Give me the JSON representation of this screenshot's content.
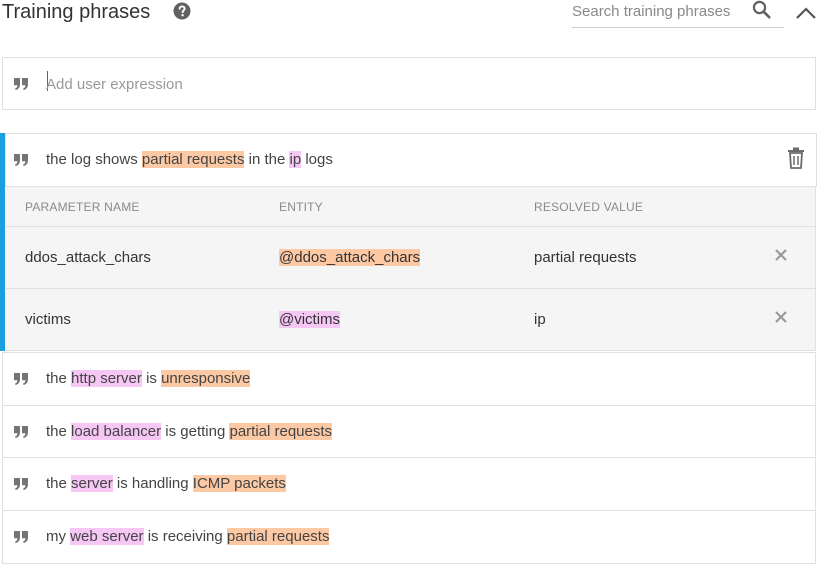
{
  "header": {
    "title": "Training phrases",
    "search_placeholder": "Search training phrases"
  },
  "add_expression": {
    "placeholder": "Add user expression"
  },
  "colors": {
    "accent": "#1a9fe0",
    "highlight_orange": "#fcc9a4",
    "highlight_pink": "#f6c6f4"
  },
  "phrases": [
    {
      "segments": [
        {
          "text": "the log shows ",
          "hl": "none"
        },
        {
          "text": "partial requests",
          "hl": "orange"
        },
        {
          "text": " in the ",
          "hl": "none"
        },
        {
          "text": "ip",
          "hl": "pink"
        },
        {
          "text": " logs",
          "hl": "none"
        }
      ]
    },
    {
      "segments": [
        {
          "text": "the ",
          "hl": "none"
        },
        {
          "text": "http server",
          "hl": "pink"
        },
        {
          "text": " is ",
          "hl": "none"
        },
        {
          "text": "unresponsive",
          "hl": "orange"
        }
      ]
    },
    {
      "segments": [
        {
          "text": "the ",
          "hl": "none"
        },
        {
          "text": "load balancer",
          "hl": "pink"
        },
        {
          "text": " is getting ",
          "hl": "none"
        },
        {
          "text": "partial requests",
          "hl": "orange"
        }
      ]
    },
    {
      "segments": [
        {
          "text": "the ",
          "hl": "none"
        },
        {
          "text": "server",
          "hl": "pink"
        },
        {
          "text": " is handling ",
          "hl": "none"
        },
        {
          "text": "ICMP packets",
          "hl": "orange"
        }
      ]
    },
    {
      "segments": [
        {
          "text": "my ",
          "hl": "none"
        },
        {
          "text": "web server",
          "hl": "pink"
        },
        {
          "text": " is receiving ",
          "hl": "none"
        },
        {
          "text": "partial requests",
          "hl": "orange"
        }
      ]
    }
  ],
  "parameters": {
    "headers": {
      "name": "PARAMETER NAME",
      "entity": "ENTITY",
      "value": "RESOLVED VALUE"
    },
    "rows": [
      {
        "name": "ddos_attack_chars",
        "entity": "@ddos_attack_chars",
        "entity_hl": "orange",
        "value": "partial requests"
      },
      {
        "name": "victims",
        "entity": "@victims",
        "entity_hl": "pink",
        "value": "ip"
      }
    ]
  },
  "icons": {
    "help": "question-circle-icon",
    "search": "search-icon",
    "collapse": "chevron-up-icon",
    "quote": "quote-icon",
    "delete": "trash-icon",
    "remove": "close-icon"
  }
}
